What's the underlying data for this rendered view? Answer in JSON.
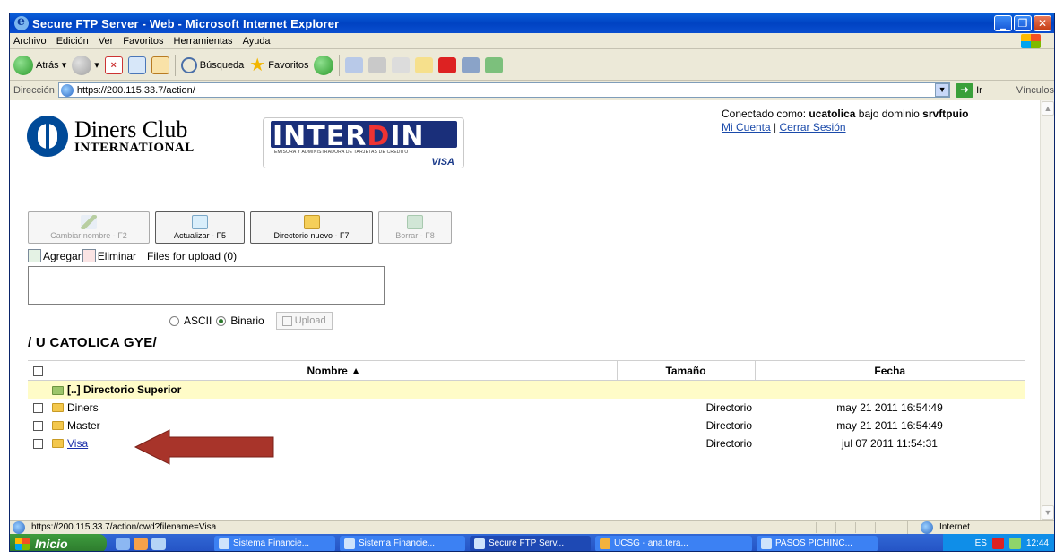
{
  "window": {
    "title": "Secure FTP Server - Web - Microsoft Internet Explorer",
    "buttons": [
      "_",
      "❐",
      "✕"
    ]
  },
  "menu": [
    "Archivo",
    "Edición",
    "Ver",
    "Favoritos",
    "Herramientas",
    "Ayuda"
  ],
  "toolbar": {
    "back": "Atrás",
    "search": "Búsqueda",
    "favorites": "Favoritos"
  },
  "address": {
    "label": "Dirección",
    "url": "https://200.115.33.7/action/",
    "go": "Ir",
    "links": "Vínculos"
  },
  "logos": {
    "diners_line1": "Diners Club",
    "diners_line2": "INTERNATIONAL",
    "interdin_a": "INTER",
    "interdin_b": "D",
    "interdin_c": "IN",
    "interdin_sub": "EMISORA Y ADMINISTRADORA DE TARJETAS DE CREDITO",
    "interdin_visa": "VISA"
  },
  "session": {
    "prefix": "Conectado como:",
    "user": "ucatolica",
    "middle": "bajo dominio",
    "domain": "srvftpuio",
    "my_account": "Mi Cuenta",
    "separator": "|",
    "logout": "Cerrar Sesión"
  },
  "actions": {
    "rename": "Cambiar nombre - F2",
    "refresh": "Actualizar - F5",
    "new_dir": "Directorio nuevo - F7",
    "delete": "Borrar - F8"
  },
  "upload": {
    "add": "Agregar",
    "remove": "Eliminar",
    "files_label": "Files for upload (0)",
    "ascii": "ASCII",
    "binary": "Binario",
    "mode_selected": "Binario",
    "button": "Upload"
  },
  "path": "/ U CATOLICA GYE/",
  "table": {
    "headers": {
      "name": "Nombre ▲",
      "size": "Tamaño",
      "date": "Fecha"
    },
    "parent": "[..] Directorio Superior",
    "rows": [
      {
        "name": "Diners",
        "size": "Directorio",
        "date": "may 21 2011 16:54:49"
      },
      {
        "name": "Master",
        "size": "Directorio",
        "date": "may 21 2011 16:54:49"
      },
      {
        "name": "Visa",
        "size": "Directorio",
        "date": "jul 07 2011 11:54:31"
      }
    ]
  },
  "status": {
    "url": "https://200.115.33.7/action/cwd?filename=Visa",
    "zone": "Internet"
  },
  "taskbar": {
    "start": "Inicio",
    "tasks": [
      "Sistema Financie...",
      "Sistema Financie...",
      "Secure FTP Serv...",
      "UCSG - ana.tera...",
      "PASOS PICHINC..."
    ],
    "lang": "ES",
    "clock": "12:44"
  },
  "colors": {
    "title_bar": "#0a4fd0",
    "highlight_arrow": "#a8342a",
    "parent_row": "#fffcc8"
  }
}
